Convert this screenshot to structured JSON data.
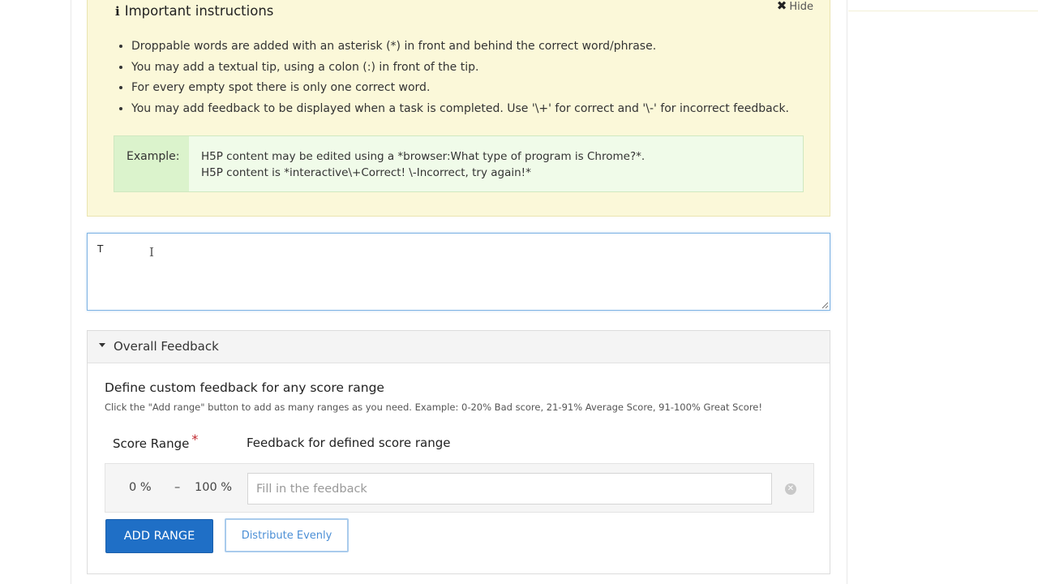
{
  "instructions": {
    "title": "Important instructions",
    "hide_label": "Hide",
    "items": [
      "Droppable words are added with an asterisk (*) in front and behind the correct word/phrase.",
      "You may add a textual tip, using a colon (:) in front of the tip.",
      "For every empty spot there is only one correct word.",
      "You may add feedback to be displayed when a task is completed. Use '\\+' for correct and '\\-' for incorrect feedback."
    ],
    "example": {
      "label": "Example:",
      "line1": "H5P content may be edited using a *browser:What type of program is Chrome?*.",
      "line2": "H5P content is *interactive\\+Correct! \\-Incorrect, try again!*"
    }
  },
  "editor": {
    "value": "T"
  },
  "overall_feedback": {
    "header": "Overall Feedback",
    "title": "Define custom feedback for any score range",
    "description": "Click the \"Add range\" button to add as many ranges as you need. Example: 0-20% Bad score, 21-91% Average Score, 91-100% Great Score!",
    "col_score": "Score Range",
    "required_mark": "*",
    "col_feedback": "Feedback for defined score range",
    "range": {
      "from": "0 %",
      "dash": "–",
      "to": "100 %",
      "placeholder": "Fill in the feedback"
    },
    "add_range_label": "ADD RANGE",
    "distribute_label": "Distribute Evenly"
  },
  "colors": {
    "instructions_bg": "#fbf8d9",
    "example_bg": "#f0fbe9",
    "primary": "#1f6fc6",
    "required": "#c0272d"
  }
}
